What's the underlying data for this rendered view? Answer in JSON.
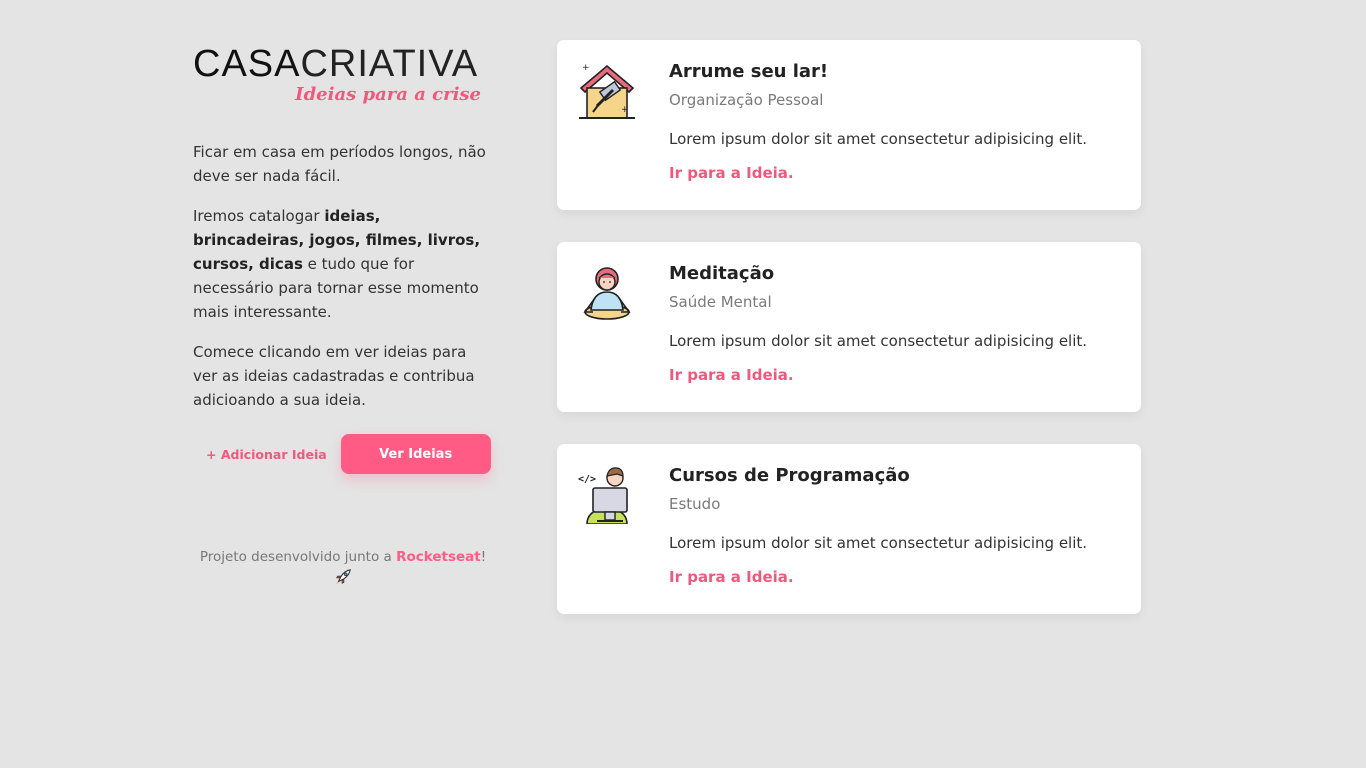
{
  "brand": {
    "title_bold": "CASA",
    "title_light": "CRIATIVA",
    "tagline": "Ideias para a crise"
  },
  "intro": {
    "p1": "Ficar em casa em períodos longos, não deve ser nada fácil.",
    "p2_start": "Iremos catalogar ",
    "p2_bold": "ideias, brincadeiras, jogos, filmes, livros, cursos, dicas",
    "p2_end": " e tudo que for necessário para tornar esse momento mais interessante.",
    "p3": "Comece clicando em ver ideias para ver as ideias cadastradas e contribua adicioando a sua ideia."
  },
  "actions": {
    "add_label": "+ Adicionar Ideia",
    "view_label": "Ver Ideias"
  },
  "footer": {
    "text": "Projeto desenvolvido junto a ",
    "brand": "Rocketseat",
    "suffix": "!"
  },
  "colors": {
    "accent": "#ff5b85",
    "background": "#e4e4e4"
  },
  "ideas": [
    {
      "title": "Arrume seu lar!",
      "category": "Organização Pessoal",
      "description": "Lorem ipsum dolor sit amet consectetur adipisicing elit.",
      "link": "Ir para a Ideia.",
      "icon": "house-cleaning-icon"
    },
    {
      "title": "Meditação",
      "category": "Saúde Mental",
      "description": "Lorem ipsum dolor sit amet consectetur adipisicing elit.",
      "link": "Ir para a Ideia.",
      "icon": "meditation-icon"
    },
    {
      "title": "Cursos de Programação",
      "category": "Estudo",
      "description": "Lorem ipsum dolor sit amet consectetur adipisicing elit.",
      "link": "Ir para a Ideia.",
      "icon": "programmer-icon"
    }
  ]
}
